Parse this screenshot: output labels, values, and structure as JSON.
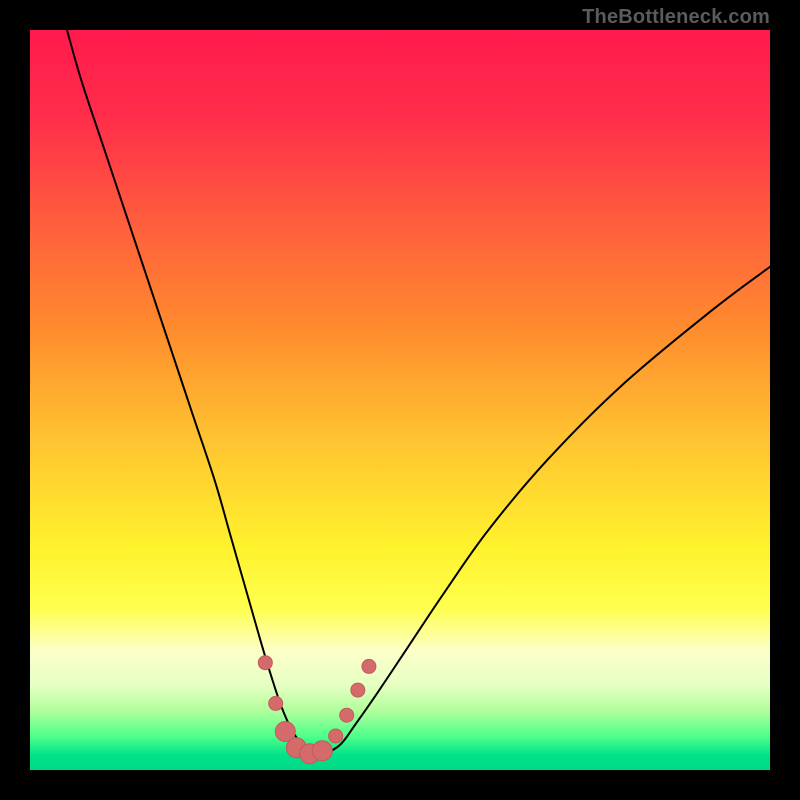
{
  "watermark": "TheBottleneck.com",
  "colors": {
    "frame": "#000000",
    "curve_stroke": "#000000",
    "marker_fill": "#d46a6a",
    "marker_stroke": "#c45a5a",
    "gradient_stops": [
      {
        "offset": 0.0,
        "color": "#ff1a4d"
      },
      {
        "offset": 0.12,
        "color": "#ff2e4a"
      },
      {
        "offset": 0.25,
        "color": "#ff5a3e"
      },
      {
        "offset": 0.4,
        "color": "#ff8a2e"
      },
      {
        "offset": 0.55,
        "color": "#ffc231"
      },
      {
        "offset": 0.7,
        "color": "#fff22e"
      },
      {
        "offset": 0.78,
        "color": "#ffff4d"
      },
      {
        "offset": 0.84,
        "color": "#fcffc9"
      },
      {
        "offset": 0.885,
        "color": "#e6ffc2"
      },
      {
        "offset": 0.92,
        "color": "#b0ff9c"
      },
      {
        "offset": 0.955,
        "color": "#4dff8a"
      },
      {
        "offset": 0.98,
        "color": "#00e38a"
      },
      {
        "offset": 1.0,
        "color": "#00d986"
      }
    ]
  },
  "chart_data": {
    "type": "line",
    "title": "",
    "xlabel": "",
    "ylabel": "",
    "xlim": [
      0,
      100
    ],
    "ylim": [
      0,
      100
    ],
    "grid": false,
    "series": [
      {
        "name": "bottleneck-curve",
        "x": [
          5,
          7,
          10,
          13,
          16,
          19,
          22,
          25,
          27,
          29,
          31,
          32.5,
          34,
          35.5,
          37,
          38.5,
          40,
          42,
          44,
          47,
          51,
          56,
          62,
          70,
          80,
          92,
          100
        ],
        "y": [
          100,
          93,
          84,
          75,
          66,
          57,
          48,
          39,
          32,
          25,
          18,
          13,
          8.5,
          5.2,
          3.2,
          2.2,
          2.3,
          3.5,
          6.2,
          10.5,
          16.5,
          24,
          32.5,
          42,
          52,
          62,
          68
        ]
      }
    ],
    "markers": {
      "name": "highlighted-points",
      "points": [
        {
          "x": 31.8,
          "y": 14.5,
          "r": 7
        },
        {
          "x": 33.2,
          "y": 9.0,
          "r": 7
        },
        {
          "x": 34.5,
          "y": 5.2,
          "r": 10
        },
        {
          "x": 36.0,
          "y": 3.0,
          "r": 10
        },
        {
          "x": 37.8,
          "y": 2.2,
          "r": 10
        },
        {
          "x": 39.5,
          "y": 2.6,
          "r": 10
        },
        {
          "x": 41.3,
          "y": 4.6,
          "r": 7
        },
        {
          "x": 42.8,
          "y": 7.4,
          "r": 7
        },
        {
          "x": 44.3,
          "y": 10.8,
          "r": 7
        },
        {
          "x": 45.8,
          "y": 14.0,
          "r": 7
        }
      ]
    }
  }
}
